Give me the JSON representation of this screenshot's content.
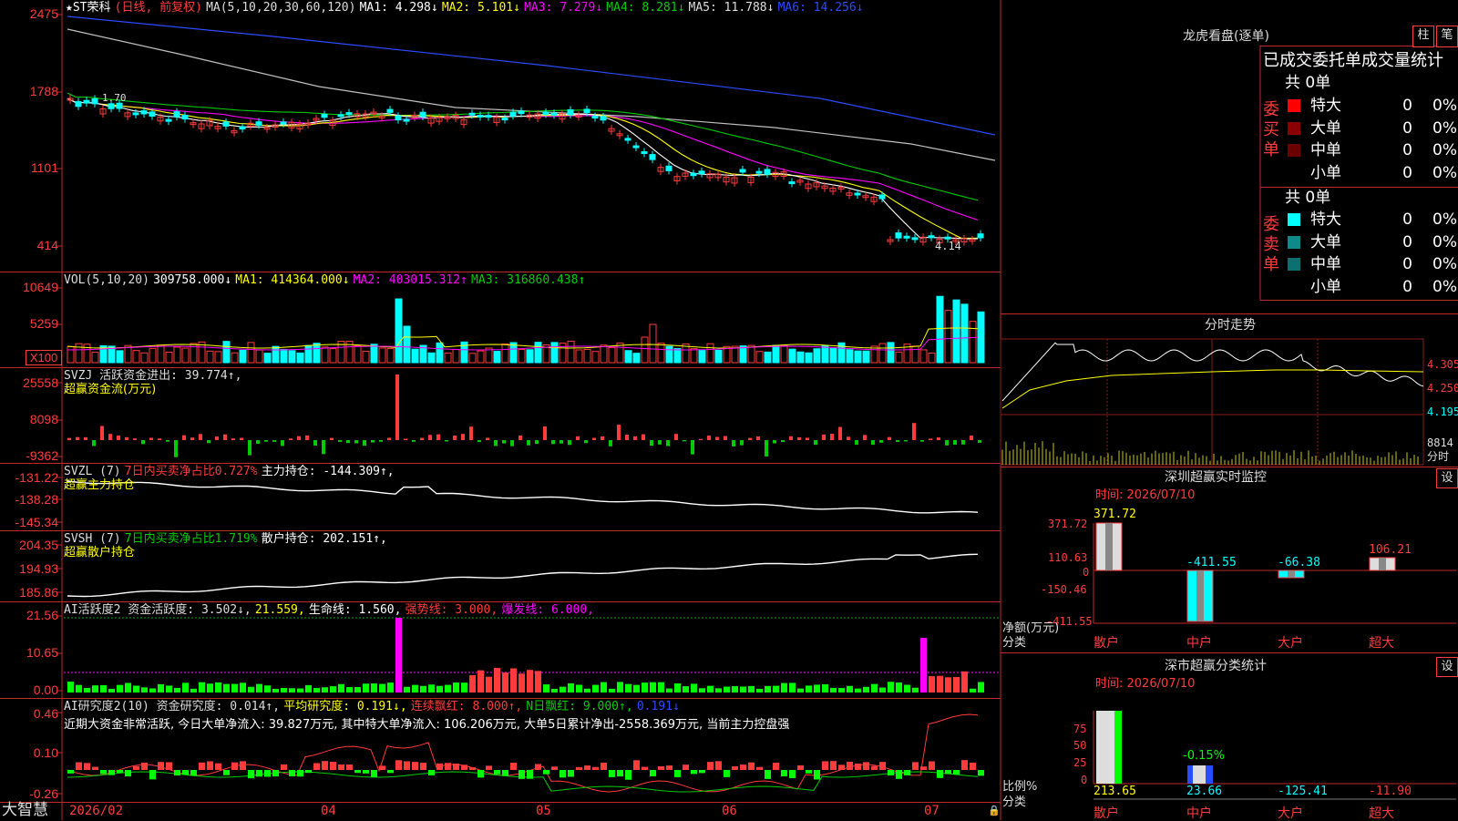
{
  "app": {
    "brand": "大智慧"
  },
  "main": {
    "price_header": {
      "name": "★ST荣科",
      "period": "(日线, 前复权)",
      "ma_label": "MA(5,10,20,30,60,120)",
      "ma1": "MA1: 4.298↓",
      "ma2": "MA2: 5.101↓",
      "ma3": "MA3: 7.279↓",
      "ma4": "MA4: 8.281↓",
      "ma5": "MA5: 11.788↓",
      "ma6": "MA6: 14.256↓"
    },
    "price_axis": [
      "2475",
      "1788",
      "1101",
      "414"
    ],
    "price_low_label": "4.14",
    "price_high_label": "1.70",
    "vol_header": {
      "label": "VOL(5,10,20)",
      "v": "309758.000↓",
      "ma1": "MA1: 414364.000↓",
      "ma2": "MA2: 403015.312↑",
      "ma3": "MA3: 316860.438↑"
    },
    "vol_axis": [
      "10649",
      "5259",
      "X100"
    ],
    "svzj": {
      "label": "SVZJ  活跃资金进出: 39.774↑,",
      "sub": "超赢资金流(万元)",
      "axis": [
        "25558",
        "8098",
        "-9362"
      ]
    },
    "svzl": {
      "label": "SVZL (7)",
      "pct": "7日内买卖净占比0.727%",
      "hold": "主力持仓: -144.309↑,",
      "sub": "超赢主力持仓",
      "axis": [
        "-131.22",
        "-138.28",
        "-145.34"
      ]
    },
    "svsh": {
      "label": "SVSH (7)",
      "pct": "7日内买卖净占比1.719%",
      "hold": "散户持仓: 202.151↑,",
      "sub": "超赢散户持仓",
      "axis": [
        "204.35",
        "194.93",
        "185.86"
      ]
    },
    "ai_active": {
      "label": "AI活跃度2 资金活跃度: 3.502↓,",
      "v2": "21.559,",
      "life": "生命线: 1.560,",
      "strong": "强势线: 3.000,",
      "burst": "爆发线: 6.000,",
      "axis": [
        "21.56",
        "10.65",
        "0.00"
      ]
    },
    "ai_research": {
      "label": "AI研究度2(10) 资金研究度: 0.014↑,",
      "avg": "平均研究度: 0.191↓,",
      "red": "连续飘红: 8.000↑,",
      "nday": "N日飘红: 9.000↑,",
      "last": "0.191↓",
      "axis": [
        "0.46",
        "0.10",
        "-0.26"
      ],
      "note": "近期大资金非常活跃, 今日大单净流入: 39.827万元, 其中特大单净流入: 106.206万元, 大单5日累计净出-2558.369万元, 当前主力控盘强"
    },
    "date_axis": [
      "2026/02",
      "04",
      "05",
      "06",
      "07"
    ]
  },
  "right": {
    "dragon": {
      "title": "龙虎看盘(逐单)",
      "tab1": "柱",
      "tab2": "笔",
      "subtitle": "已成交委托单成交量统计",
      "buy": {
        "side": "委买单",
        "total": "共 0单",
        "rows": [
          {
            "name": "特大",
            "v": "0",
            "p": "0%",
            "color": "#ff0000"
          },
          {
            "name": "大单",
            "v": "0",
            "p": "0%",
            "color": "#8b0000"
          },
          {
            "name": "中单",
            "v": "0",
            "p": "0%",
            "color": "#6b0000"
          },
          {
            "name": "小单",
            "v": "0",
            "p": "0%",
            "color": ""
          }
        ]
      },
      "sell": {
        "side": "委卖单",
        "total": "共 0单",
        "rows": [
          {
            "name": "特大",
            "v": "0",
            "p": "0%",
            "color": "#00ffff"
          },
          {
            "name": "大单",
            "v": "0",
            "p": "0%",
            "color": "#0f8a8a"
          },
          {
            "name": "中单",
            "v": "0",
            "p": "0%",
            "color": "#0c7070"
          },
          {
            "name": "小单",
            "v": "0",
            "p": "0%",
            "color": ""
          }
        ]
      }
    },
    "intraday": {
      "title": "分时走势",
      "p_top": "4.305",
      "p_mid": "4.250",
      "p_low": "4.195",
      "vol": "8814",
      "vol_unit": "分时"
    },
    "sz_monitor": {
      "title": "深圳超赢实时监控",
      "btn": "设",
      "time": "时间: 2026/07/10",
      "axis": [
        "371.72",
        "110.63",
        "0",
        "-150.46",
        "-411.55"
      ],
      "ylabel": "净额(万元)",
      "xlabel": "分类",
      "categories": [
        "散户",
        "中户",
        "大户",
        "超大"
      ],
      "values": [
        "371.72",
        "-411.55",
        "-66.38",
        "106.21"
      ]
    },
    "sz_class": {
      "title": "深市超赢分类统计",
      "btn": "设",
      "time": "时间: 2026/07/10",
      "axis": [
        "75",
        "50",
        "25",
        "0"
      ],
      "ylabel": "比例%",
      "xlabel": "分类",
      "categories": [
        "散户",
        "中户",
        "大户",
        "超大"
      ],
      "values": [
        "213.65",
        "23.66",
        "-125.41",
        "-11.90"
      ],
      "mid_label": "-0.15%"
    }
  },
  "colors": {
    "up": "#ff3b3b",
    "down": "#00ffff",
    "ma1": "#ffffff",
    "ma2": "#ffff00",
    "ma3": "#ff00ff",
    "ma4": "#00cc00",
    "ma5": "#c0c0c0",
    "ma6": "#2a4cff"
  }
}
